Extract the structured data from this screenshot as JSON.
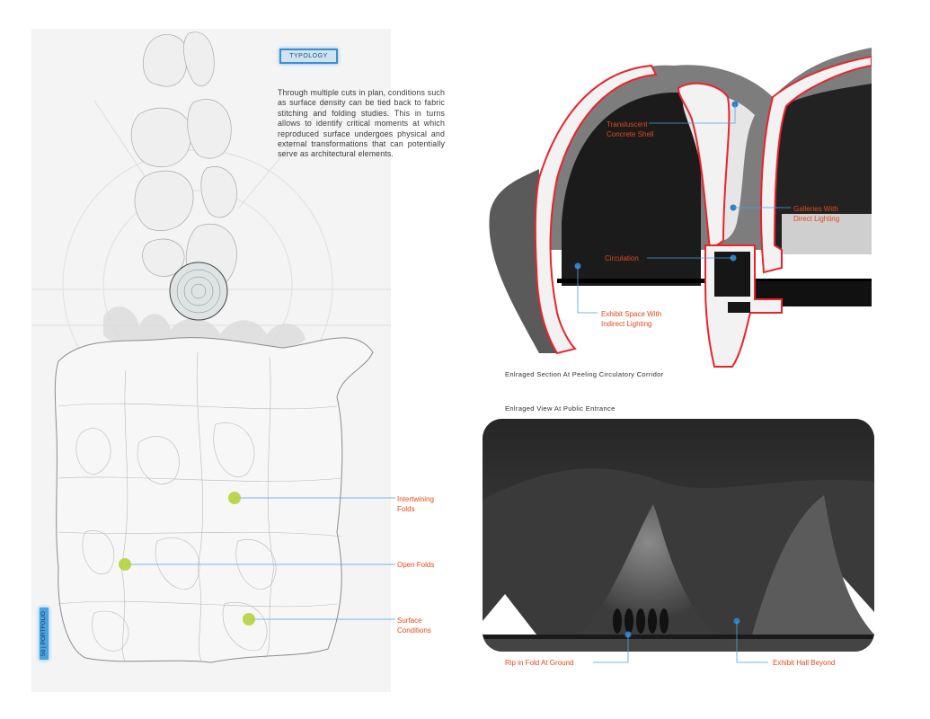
{
  "tag": {
    "label": "TYPOLOGY"
  },
  "intro": {
    "text": "Through multiple cuts in plan, conditions such as surface density can be tied back to fabric stitching and folding studies. This in turns allows to identify critical moments at which reproduced surface undergoes physical and external transformations that can potentially serve as architectural elements."
  },
  "plan_callouts": [
    {
      "label_line1": "Intertwining",
      "label_line2": "Folds"
    },
    {
      "label_line1": "Open Folds",
      "label_line2": ""
    },
    {
      "label_line1": "Surface",
      "label_line2": "Conditions"
    }
  ],
  "section": {
    "callouts": [
      {
        "line1": "Transluscent",
        "line2": "Concrete Shell"
      },
      {
        "line1": "Galleries With",
        "line2": "Direct Lighting"
      },
      {
        "line1": "Circulation",
        "line2": ""
      },
      {
        "line1": "Exhibit Space With",
        "line2": "Indirect Lighting"
      }
    ],
    "caption": "Enlraged Section At Peeling Circulatory Corridor"
  },
  "entrance": {
    "caption": "Enlraged View At Public Entrance",
    "callouts": [
      {
        "label": "Rip in Fold At Ground"
      },
      {
        "label": "Exhibit Hall Beyond"
      }
    ]
  },
  "page_number": {
    "text": "50 | PORTFOLIO"
  },
  "colors": {
    "accent": "#e04a1e",
    "marker_green": "#b5d33c",
    "marker_blue": "#2d7fc7",
    "section_outline": "#e8252b"
  }
}
